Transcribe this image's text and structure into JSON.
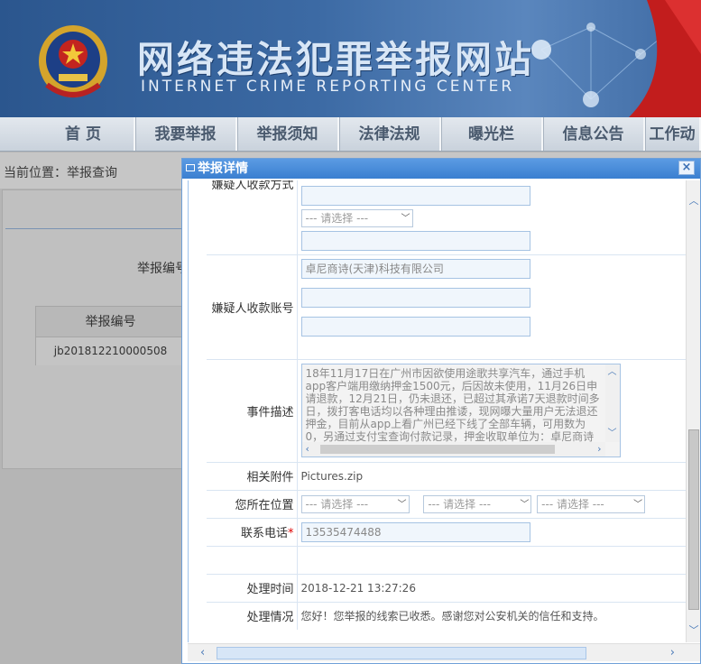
{
  "header": {
    "title": "网络违法犯罪举报网站",
    "subtitle": "INTERNET CRIME REPORTING CENTER"
  },
  "nav": [
    {
      "label": "首  页",
      "w": 150
    },
    {
      "label": "我要举报",
      "w": 113
    },
    {
      "label": "举报须知",
      "w": 113
    },
    {
      "label": "法律法规",
      "w": 113
    },
    {
      "label": "曝光栏",
      "w": 113
    },
    {
      "label": "信息公告",
      "w": 113
    },
    {
      "label": "工作动",
      "w": 62
    }
  ],
  "breadcrumb": "当前位置：举报查询",
  "background": {
    "label": "举报编号",
    "table_header": "举报编号",
    "table_value": "jb201812210000508"
  },
  "modal": {
    "title": "举报详情",
    "close": "×",
    "select_placeholder": "--- 请选择 ---",
    "fields": {
      "payment_method_label": "嫌疑人收款方式",
      "account_label": "嫌疑人收款账号",
      "account_value": "卓尼商诗(天津)科技有限公司",
      "description_label": "事件描述",
      "description_value": "18年11月17日在广州市因欲使用途歌共享汽车，通过手机app客户端用缴纳押金1500元，后因故未使用，11月26日申请退款，12月21日，仍未退还，已超过其承诺7天退款时间多日，拨打客电话均以各种理由推诿，现网曝大量用户无法退还押金，目前从app上看广州已经下线了全部车辆，可用数为0，另通过支付宝查询付款记录，押金收取单位为：卓尼商诗（天津）科技有限公司，",
      "attachment_label": "相关附件",
      "attachment_value": "Pictures.zip",
      "location_label": "您所在位置",
      "phone_label": "联系电话",
      "phone_required": "*",
      "phone_value": "13535474488",
      "processed_time_label": "处理时间",
      "processed_time_value": "2018-12-21 13:27:26",
      "processing_label": "处理情况",
      "processing_value": "您好！您举报的线索已收悉。感谢您对公安机关的信任和支持。"
    }
  },
  "colors": {
    "modal_header": "#3a7fd0",
    "field_border": "#a6c3e3",
    "required": "#dd0000"
  }
}
